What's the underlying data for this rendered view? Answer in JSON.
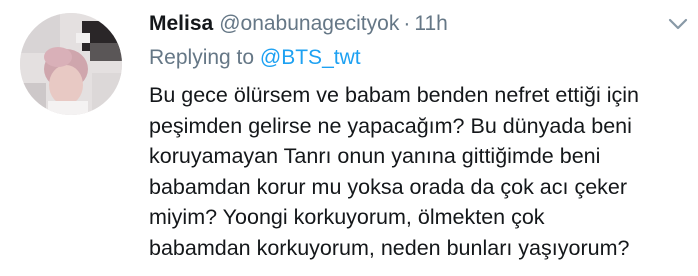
{
  "tweet": {
    "display_name": "Melisa",
    "handle": "@onabunagecityok",
    "separator": "·",
    "time": "11h",
    "replying_to_prefix": "Replying to",
    "replying_to_mention": "@BTS_twt",
    "body_lines": [
      "Bu gece ölürsem ve babam benden nefret ettiği için",
      "peşimden gelirse ne yapacağım? Bu dünyada beni",
      "koruyamayan Tanrı onun yanına gittiğimde beni",
      "babamdan korur mu yoksa orada da çok acı çeker",
      "miyim? Yoongi korkuyorum, ölmekten çok",
      "babamdan korkuyorum, neden bunları yaşıyorum?"
    ]
  },
  "icons": {
    "caret": "chevron-down-icon",
    "avatar": "avatar"
  },
  "colors": {
    "text_primary": "#14171a",
    "text_secondary": "#657786",
    "link": "#1da1f2",
    "background": "#ffffff"
  }
}
